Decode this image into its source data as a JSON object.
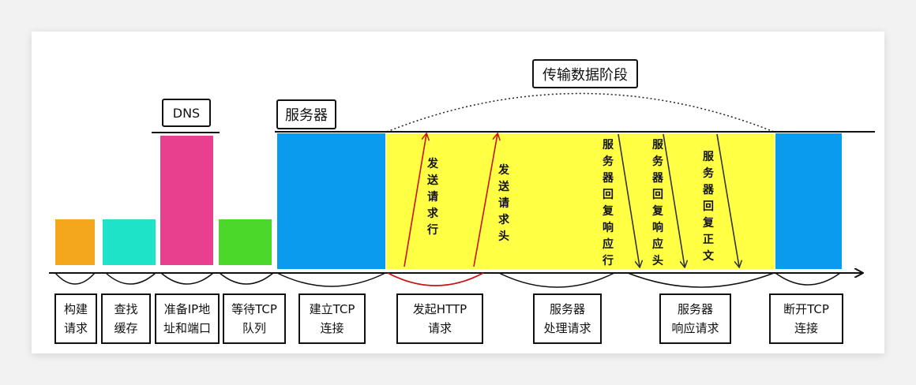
{
  "labels": {
    "dns": "DNS",
    "server": "服务器",
    "transfer_phase": "传输数据阶段"
  },
  "stages": [
    {
      "id": "build-request",
      "line1": "构建",
      "line2": "请求",
      "color": "#f4a71d"
    },
    {
      "id": "check-cache",
      "line1": "查找",
      "line2": "缓存",
      "color": "#1ee3c8"
    },
    {
      "id": "prepare-ip",
      "line1": "准备IP地",
      "line2": "址和端口",
      "color": "#e8408f"
    },
    {
      "id": "wait-tcp",
      "line1": "等待TCP",
      "line2": "队列",
      "color": "#4cd82a"
    },
    {
      "id": "establish-tcp",
      "line1": "建立TCP",
      "line2": "连接",
      "color": "#0a9bef"
    },
    {
      "id": "send-http",
      "line1": "发起HTTP",
      "line2": "请求",
      "color": "#ffff44"
    },
    {
      "id": "server-process",
      "line1": "服务器",
      "line2": "处理请求",
      "color": "#ffff44"
    },
    {
      "id": "server-respond",
      "line1": "服务器",
      "line2": "响应请求",
      "color": "#ffff44"
    },
    {
      "id": "close-tcp",
      "line1": "断开TCP",
      "line2": "连接",
      "color": "#0a9bef"
    }
  ],
  "messages": [
    {
      "id": "send-request-line",
      "text": "发送请求行",
      "direction": "up",
      "color": "#cc1111"
    },
    {
      "id": "send-request-header",
      "text": "发送请求头",
      "direction": "up",
      "color": "#cc1111"
    },
    {
      "id": "response-line",
      "text": "服务器回复响应行",
      "direction": "down",
      "color": "#333333"
    },
    {
      "id": "response-header",
      "text": "服务器回复响应头",
      "direction": "down",
      "color": "#333333"
    },
    {
      "id": "response-body",
      "text": "服务器回复正文",
      "direction": "down",
      "color": "#333333"
    }
  ]
}
